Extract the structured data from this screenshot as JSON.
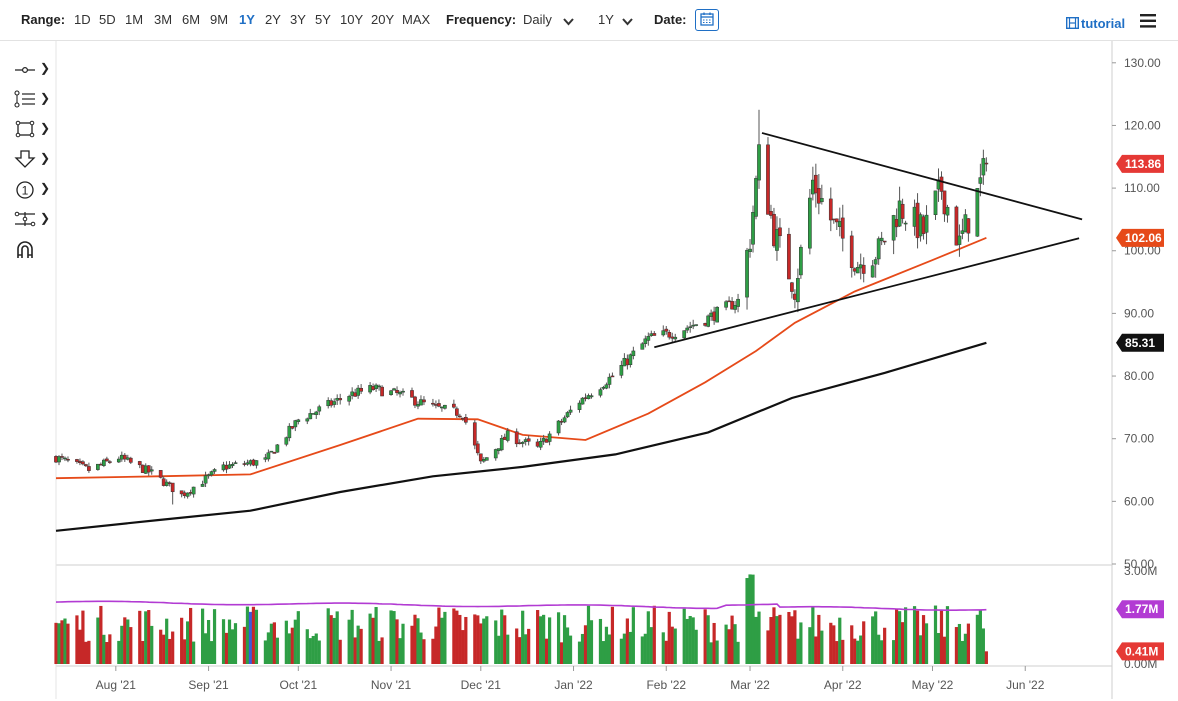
{
  "toolbar": {
    "range_label": "Range:",
    "ranges": [
      "1D",
      "5D",
      "1M",
      "3M",
      "6M",
      "9M",
      "1Y",
      "2Y",
      "3Y",
      "5Y",
      "10Y",
      "20Y",
      "MAX"
    ],
    "active_range": "1Y",
    "frequency_label": "Frequency:",
    "frequency_value": "Daily",
    "period_value": "1Y",
    "date_label": "Date:",
    "tutorial_label": "tutorial",
    "icons": [
      "calendar-icon",
      "tutorial-film-icon",
      "hamburger-menu-icon"
    ]
  },
  "left_tools": [
    "crosshair-line-tool-icon",
    "fibonacci-tool-icon",
    "rectangle-tool-icon",
    "arrow-marker-tool-icon",
    "number-marker-tool-icon",
    "measure-tool-icon",
    "magnet-tool-icon"
  ],
  "left_tools_number_glyph": "1",
  "colors": {
    "up": "#2e9e45",
    "down": "#c62828",
    "ma_short": "#e64a19",
    "ma_long": "#111111",
    "volume_avg": "#b23bd3",
    "badge_last": "#e53935",
    "badge_ma_long": "#111111",
    "badge_vol_avg": "#b23bd3"
  },
  "chart_data": {
    "type": "candlestick",
    "price_axis": {
      "ticks": [
        "130.00",
        "120.00",
        "110.00",
        "100.00",
        "90.00",
        "80.00",
        "70.00",
        "60.00",
        "50.00"
      ],
      "ylim": [
        50,
        133
      ]
    },
    "volume_axis": {
      "ticks": [
        "3.00M",
        "0.00M"
      ],
      "ylim": [
        0,
        3.2
      ]
    },
    "x_ticks": [
      "Aug '21",
      "Sep '21",
      "Oct '21",
      "Nov '21",
      "Dec '21",
      "Jan '22",
      "Feb '22",
      "Mar '22",
      "Apr '22",
      "May '22",
      "Jun '22"
    ],
    "x_tick_dates": [
      "2021-08-01",
      "2021-09-01",
      "2021-10-01",
      "2021-11-01",
      "2021-12-01",
      "2022-01-01",
      "2022-02-01",
      "2022-03-01",
      "2022-04-01",
      "2022-05-01",
      "2022-06-01"
    ],
    "x_range": [
      "2021-07-12",
      "2022-06-30"
    ],
    "last_date": "2022-05-19",
    "close_anchors": [
      [
        "2021-07-12",
        67
      ],
      [
        "2021-07-23",
        65
      ],
      [
        "2021-08-02",
        67
      ],
      [
        "2021-08-13",
        64.5
      ],
      [
        "2021-08-23",
        61
      ],
      [
        "2021-09-06",
        65.5
      ],
      [
        "2021-09-20",
        66.5
      ],
      [
        "2021-10-01",
        73
      ],
      [
        "2021-10-18",
        77
      ],
      [
        "2021-10-26",
        78
      ],
      [
        "2021-11-04",
        77
      ],
      [
        "2021-11-15",
        75
      ],
      [
        "2021-11-25",
        74
      ],
      [
        "2021-12-01",
        66
      ],
      [
        "2021-12-10",
        70.5
      ],
      [
        "2021-12-20",
        68.5
      ],
      [
        "2022-01-03",
        76
      ],
      [
        "2022-01-14",
        80
      ],
      [
        "2022-01-26",
        86
      ],
      [
        "2022-02-04",
        87
      ],
      [
        "2022-02-14",
        89
      ],
      [
        "2022-02-25",
        92
      ],
      [
        "2022-03-01",
        102
      ],
      [
        "2022-03-04",
        115
      ],
      [
        "2022-03-09",
        103
      ],
      [
        "2022-03-16",
        94
      ],
      [
        "2022-03-22",
        111
      ],
      [
        "2022-03-29",
        104
      ],
      [
        "2022-04-06",
        98
      ],
      [
        "2022-04-13",
        100
      ],
      [
        "2022-04-20",
        107
      ],
      [
        "2022-04-28",
        103
      ],
      [
        "2022-05-04",
        110
      ],
      [
        "2022-05-10",
        101
      ],
      [
        "2022-05-16",
        109
      ],
      [
        "2022-05-19",
        113.86
      ]
    ],
    "wick_extremes": {
      "high": 122.5,
      "high_date": "2022-03-04",
      "low": 59.5,
      "low_date": "2021-08-20"
    },
    "ma_short": {
      "name": "",
      "points": [
        [
          "2021-07-12",
          63.7
        ],
        [
          "2021-08-15",
          64.0
        ],
        [
          "2021-09-15",
          64.3
        ],
        [
          "2021-10-15",
          69.0
        ],
        [
          "2021-11-10",
          73.2
        ],
        [
          "2021-11-30",
          73.1
        ],
        [
          "2021-12-15",
          70.6
        ],
        [
          "2022-01-05",
          69.8
        ],
        [
          "2022-01-26",
          74.0
        ],
        [
          "2022-02-14",
          79.0
        ],
        [
          "2022-03-03",
          84.0
        ],
        [
          "2022-03-16",
          88.5
        ],
        [
          "2022-04-05",
          93.5
        ],
        [
          "2022-05-01",
          98.5
        ],
        [
          "2022-05-19",
          102.06
        ]
      ]
    },
    "ma_long": {
      "name": "",
      "points": [
        [
          "2021-07-12",
          55.3
        ],
        [
          "2021-08-15",
          57.0
        ],
        [
          "2021-09-15",
          58.5
        ],
        [
          "2021-10-15",
          61.5
        ],
        [
          "2021-11-15",
          64.0
        ],
        [
          "2021-12-15",
          65.5
        ],
        [
          "2022-01-15",
          67.5
        ],
        [
          "2022-02-15",
          71.0
        ],
        [
          "2022-03-15",
          76.5
        ],
        [
          "2022-04-15",
          80.5
        ],
        [
          "2022-05-19",
          85.31
        ]
      ]
    },
    "trendlines": [
      {
        "from": [
          "2022-03-05",
          118.8
        ],
        "to": [
          "2022-06-20",
          105.0
        ]
      },
      {
        "from": [
          "2022-01-28",
          84.6
        ],
        "to": [
          "2022-06-19",
          102.0
        ]
      }
    ],
    "last_values": {
      "price": "113.86",
      "ma_short": "102.06",
      "ma_long": "85.31",
      "volume_avg": "1.77M",
      "volume_last": "0.41M"
    },
    "volume": {
      "avg_level": 1.77,
      "avg_start": 2.0,
      "peak_date": "2022-03-01",
      "peak": 3.05,
      "typical_range": [
        0.7,
        1.9
      ],
      "blue_bar_date": "2021-09-15"
    }
  }
}
